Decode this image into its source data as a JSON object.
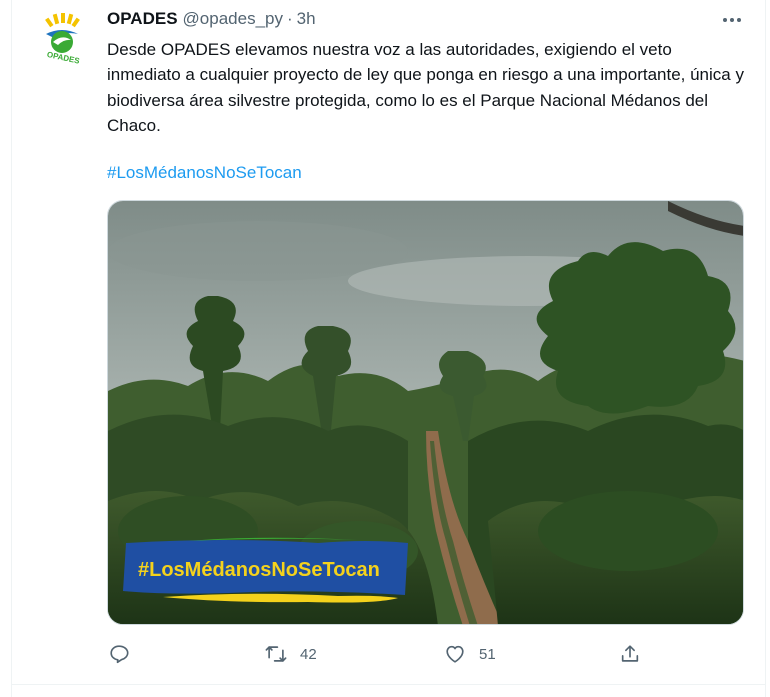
{
  "tweet": {
    "display_name": "OPADES",
    "handle": "@opades_py",
    "separator": "·",
    "time": "3h",
    "text": "Desde OPADES elevamos nuestra voz a las autoridades, exigiendo el veto inmediato a cualquier proyecto de ley que ponga en riesgo a una importante, única y biodiversa área silvestre protegida, como lo es el Parque Nacional Médanos del Chaco.",
    "hashtag": "#LosMédanosNoSeTocan",
    "avatar_logo_text": "OPADES",
    "media": {
      "banner_text": "#LosMédanosNoSeTocan",
      "colors": {
        "banner_blue": "#1f4fa3",
        "banner_yellow": "#f4d21c",
        "banner_text": "#f4d21c"
      }
    }
  },
  "actions": {
    "reply_icon": "reply-icon",
    "retweet_icon": "retweet-icon",
    "retweet_count": "42",
    "like_icon": "heart-icon",
    "like_count": "51",
    "share_icon": "share-icon"
  },
  "colors": {
    "text_primary": "#0f1419",
    "text_secondary": "#536471",
    "link": "#1d9bf0",
    "border": "#eff3f4"
  }
}
